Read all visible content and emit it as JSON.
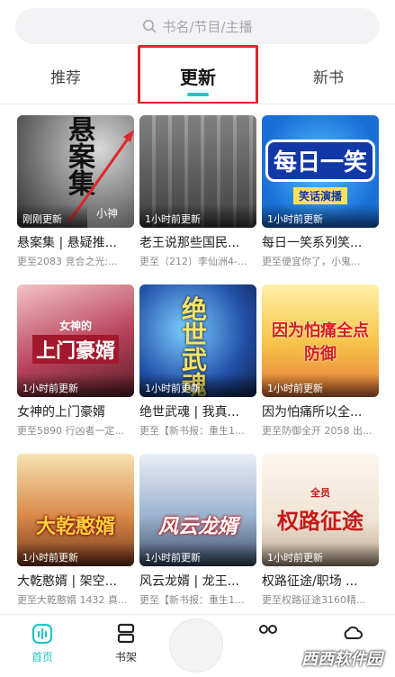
{
  "search": {
    "placeholder": "书名/节目/主播"
  },
  "tabs": [
    {
      "label": "推荐"
    },
    {
      "label": "更新"
    },
    {
      "label": "新书"
    }
  ],
  "books": [
    {
      "title": "悬案集 | 悬疑推...",
      "sub": "更至2083 竞合之光:...",
      "badge": "刚刚更新",
      "cover_text": "悬案集",
      "cover_sub": "小神"
    },
    {
      "title": "老王说那些国民...",
      "sub": "更至（212）李仙洲4-...",
      "badge": "1小时前更新",
      "cover_text": "",
      "cover_sub": ""
    },
    {
      "title": "每日一笑系列笑...",
      "sub": "更至便宜你了，小鬼...",
      "badge": "1小时前更新",
      "cover_text": "每日一笑",
      "cover_sub": "笑话演播"
    },
    {
      "title": "女神的上门豪婿",
      "sub": "更至5890 行凶者一定...",
      "badge": "1小时前更新",
      "cover_text": "上门豪婿",
      "cover_sub": "女神的"
    },
    {
      "title": "绝世武魂 | 我真...",
      "sub": "更至【新书报：重生1...",
      "badge": "1小时前更新",
      "cover_text": "绝世武魂",
      "cover_sub": ""
    },
    {
      "title": "因为怕痛所以全...",
      "sub": "更至防御全开 2058 出...",
      "badge": "1小时前更新",
      "cover_text": "因为怕痛全点防御",
      "cover_sub": ""
    },
    {
      "title": "大乾憨婿 | 架空...",
      "sub": "更至大乾憨婿 1432 真...",
      "badge": "1小时前更新",
      "cover_text": "大乾憨婿",
      "cover_sub": ""
    },
    {
      "title": "风云龙婿 | 龙王...",
      "sub": "更至【新书报：重生1...",
      "badge": "1小时前更新",
      "cover_text": "风云龙婿",
      "cover_sub": ""
    },
    {
      "title": "权路征途/职场 ...",
      "sub": "更至权路征途3160精...",
      "badge": "1小时前更新",
      "cover_text": "权路征途",
      "cover_sub": "全员"
    }
  ],
  "bottom_nav": {
    "home": "首页",
    "shelf": "书架"
  },
  "watermark": "西西软件园",
  "colors": {
    "accent": "#23c4c4",
    "highlight": "#e0262a"
  }
}
